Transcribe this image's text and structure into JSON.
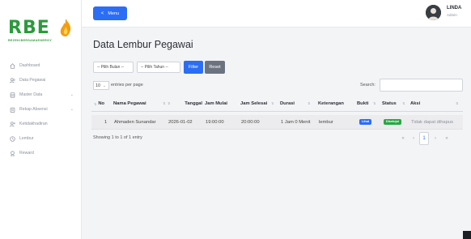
{
  "brand": {
    "logo_text": "RBE",
    "logo_sub": "REZEKIBERSAMAENERGY"
  },
  "sidebar": {
    "items": [
      {
        "label": "Dashboard",
        "icon": "home-icon",
        "has_submenu": false
      },
      {
        "label": "Data Pegawai",
        "icon": "users-icon",
        "has_submenu": false
      },
      {
        "label": "Master Data",
        "icon": "database-icon",
        "has_submenu": true
      },
      {
        "label": "Rekap Absensi",
        "icon": "clipboard-icon",
        "has_submenu": true
      },
      {
        "label": "Ketidakhadiran",
        "icon": "user-x-icon",
        "has_submenu": false
      },
      {
        "label": "Lembur",
        "icon": "clock-icon",
        "has_submenu": false
      },
      {
        "label": "Reward",
        "icon": "award-icon",
        "has_submenu": false
      }
    ],
    "chevron": "⌄"
  },
  "topbar": {
    "menu_label": "Menu",
    "menu_icon": "<",
    "user_name": "LINDA",
    "user_role": "Admin"
  },
  "page": {
    "title": "Data Lembur Pegawai"
  },
  "filters": {
    "month_placeholder": "-- Pilih Bulan --",
    "year_placeholder": "-- Pilih Tahun --",
    "filter_label": "Filter",
    "reset_label": "Reset"
  },
  "table_controls": {
    "page_length": "10",
    "length_suffix": "entries per page",
    "search_label": "Search:",
    "search_value": ""
  },
  "table": {
    "columns": [
      "No",
      "Nama Pegawai",
      "Tanggal",
      "Jam Mulai",
      "Jam Selesai",
      "Durasi",
      "Keterangan",
      "Bukti",
      "Status",
      "Aksi"
    ],
    "rows": [
      {
        "no": "1",
        "nama": "Ahmaden Sunandar",
        "tanggal": "2026-01-02",
        "jam_mulai": "19:00:00",
        "jam_selesai": "20:00:00",
        "durasi": "1 Jam 0 Menit",
        "keterangan": "lembur",
        "bukti": "Lihat",
        "status": "Disetujui",
        "aksi": "Tidak dapat dihapus"
      }
    ],
    "info": "Showing 1 to 1 of 1 entry"
  },
  "pagination": {
    "first": "«",
    "prev": "‹",
    "current": "1",
    "next": "›",
    "last": "»"
  },
  "colors": {
    "accent": "#2b6df5",
    "reset": "#6c7380",
    "brand_green": "#2c9a3c",
    "brand_orange": "#f39c12",
    "badge_green": "#28a745"
  }
}
